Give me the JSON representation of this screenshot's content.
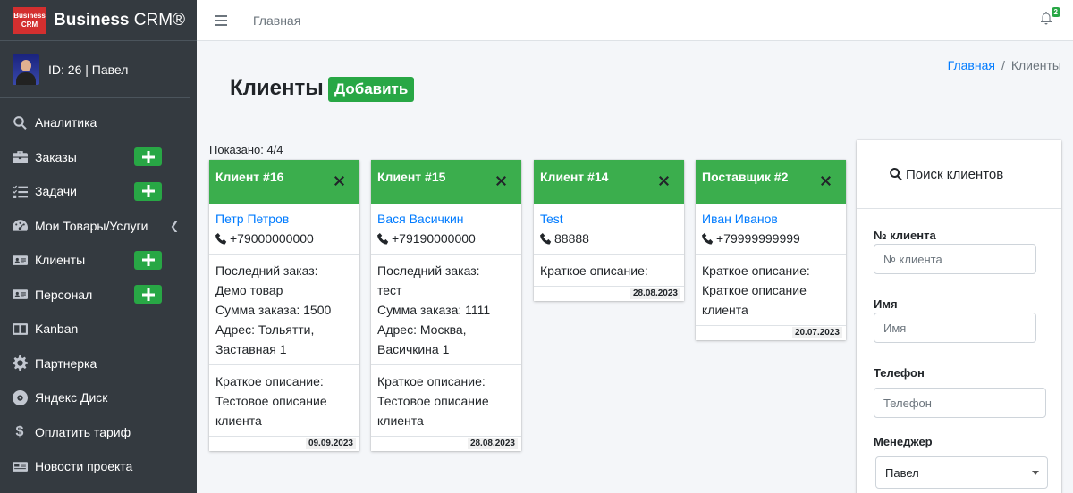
{
  "brand": {
    "logo_line1": "Business",
    "logo_line2": "CRM",
    "name_bold": "Business",
    "name_rest": " CRM®"
  },
  "user": {
    "label": "ID: 26 | Павел"
  },
  "sidebar": {
    "items": [
      {
        "label": "Аналитика",
        "icon": "search-icon"
      },
      {
        "label": "Заказы",
        "icon": "briefcase-icon"
      },
      {
        "label": "Задачи",
        "icon": "tasks-icon"
      },
      {
        "label": "Мои Товары/Услуги",
        "icon": "dashboard-icon"
      },
      {
        "label": "Клиенты",
        "icon": "id-card-icon"
      },
      {
        "label": "Персонал",
        "icon": "id-card-icon"
      },
      {
        "label": "Kanban",
        "icon": "columns-icon"
      },
      {
        "label": "Партнерка",
        "icon": "gear-icon"
      },
      {
        "label": "Яндекс Диск",
        "icon": "disk-icon"
      },
      {
        "label": "Оплатить тариф",
        "icon": "dollar-icon"
      },
      {
        "label": "Новости проекта",
        "icon": "news-icon"
      }
    ]
  },
  "topbar": {
    "home_link": "Главная",
    "notification_count": "2"
  },
  "page": {
    "title": "Клиенты",
    "add_button": "Добавить",
    "shown": "Показано: 4/4"
  },
  "breadcrumb": {
    "home": "Главная",
    "separator": "/",
    "current": "Клиенты"
  },
  "cards": [
    {
      "header": "Клиент #16",
      "name": "Петр Петров",
      "phone": "+79000000000",
      "order_lines": [
        "Последний заказ:",
        "Демо товар",
        "Сумма заказа: 1500",
        "Адрес: Тольятти,",
        "Заставная 1"
      ],
      "desc_lines": [
        "Краткое описание:",
        "Тестовое описание",
        "клиента"
      ],
      "date": "09.09.2023"
    },
    {
      "header": "Клиент #15",
      "name": "Вася Васичкин",
      "phone": "+79190000000",
      "order_lines": [
        "Последний заказ:",
        "тест",
        "Сумма заказа: 1111",
        "Адрес: Москва,",
        "Васичкина 1"
      ],
      "desc_lines": [
        "Краткое описание:",
        "Тестовое описание",
        "клиента"
      ],
      "date": "28.08.2023"
    },
    {
      "header": "Клиент #14",
      "name": "Test",
      "phone": "88888",
      "desc_lines": [
        "Краткое описание:"
      ],
      "date": "28.08.2023"
    },
    {
      "header": "Поставщик #2",
      "name": "Иван Иванов",
      "phone": "+79999999999",
      "desc_lines": [
        "Краткое описание:",
        "Краткое описание",
        "клиента"
      ],
      "date": "20.07.2023"
    }
  ],
  "search": {
    "title": "Поиск клиентов",
    "number_label": "№ клиента",
    "number_placeholder": "№ клиента",
    "name_label": "Имя",
    "name_placeholder": "Имя",
    "phone_label": "Телефон",
    "phone_placeholder": "Телефон",
    "manager_label": "Менеджер",
    "manager_value": "Павел"
  }
}
